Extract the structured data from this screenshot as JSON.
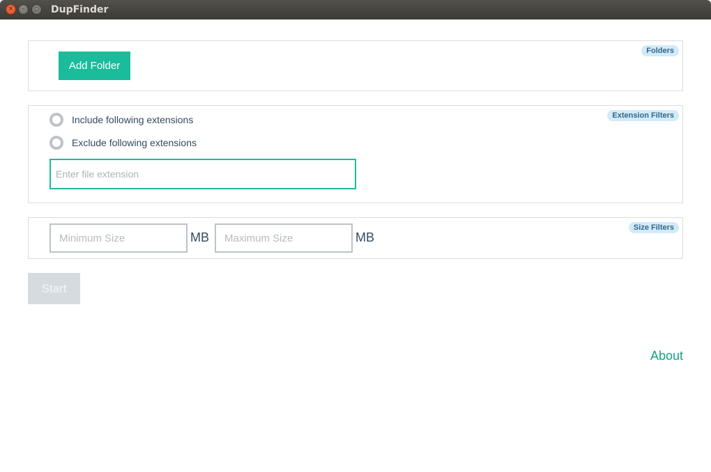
{
  "window": {
    "title": "DupFinder",
    "controls": {
      "close": "×",
      "minimize": "–",
      "maximize": "□"
    }
  },
  "folders": {
    "badge": "Folders",
    "add_button": "Add Folder"
  },
  "extensions": {
    "badge": "Extension Filters",
    "include_label": "Include following extensions",
    "exclude_label": "Exclude following extensions",
    "include_selected": false,
    "exclude_selected": false,
    "input_value": "",
    "input_placeholder": "Enter file extension"
  },
  "size": {
    "badge": "Size Filters",
    "min_placeholder": "Minimum Size",
    "min_value": "",
    "min_unit": "MB",
    "max_placeholder": "Maximum Size",
    "max_value": "",
    "max_unit": "MB"
  },
  "actions": {
    "start_label": "Start",
    "about_label": "About"
  },
  "colors": {
    "accent": "#1abc9c",
    "link": "#16a085",
    "badge_bg": "#d3eaf8",
    "badge_text": "#33678a",
    "disabled_button": "#d6dbdf",
    "text": "#34495e"
  }
}
